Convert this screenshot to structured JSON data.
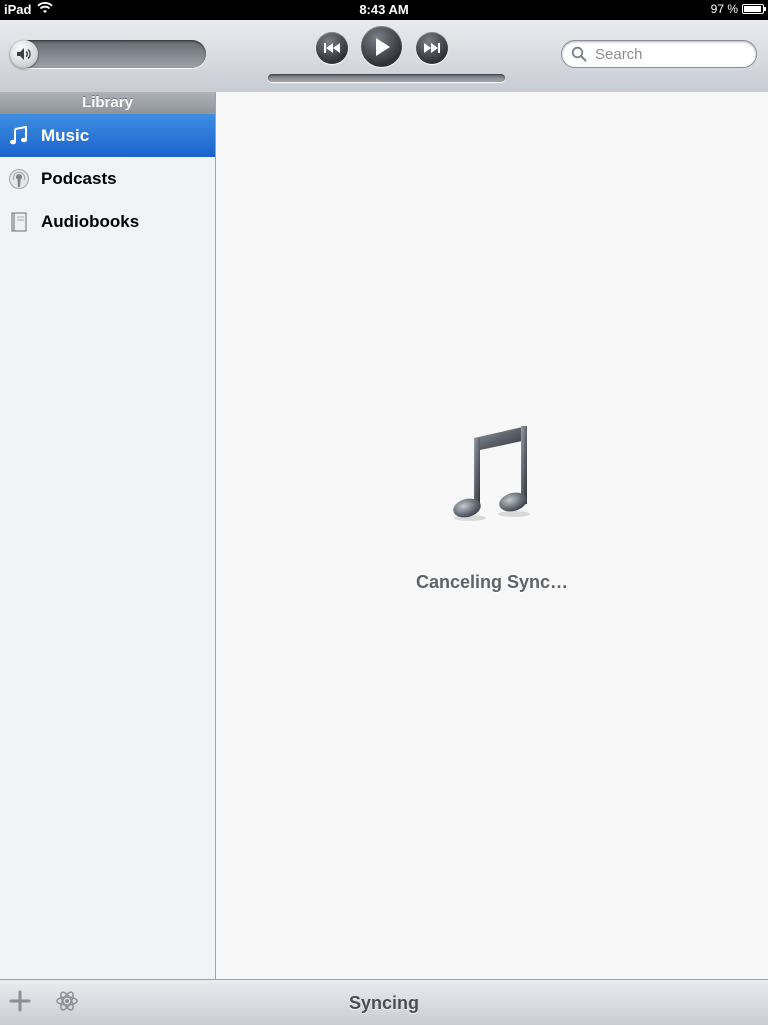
{
  "status_bar": {
    "device": "iPad",
    "time": "8:43 AM",
    "battery": "97 %",
    "battery_level": 0.97
  },
  "toolbar": {
    "prev_icon": "rewind-icon",
    "play_icon": "play-icon",
    "next_icon": "fast-forward-icon",
    "volume_icon": "speaker-icon",
    "search_placeholder": "Search",
    "search_value": ""
  },
  "sidebar": {
    "header": "Library",
    "items": [
      {
        "label": "Music",
        "icon": "music-note-icon",
        "selected": true
      },
      {
        "label": "Podcasts",
        "icon": "podcast-icon",
        "selected": false
      },
      {
        "label": "Audiobooks",
        "icon": "book-icon",
        "selected": false
      }
    ]
  },
  "main": {
    "message": "Canceling Sync…",
    "icon": "itunes-note-icon"
  },
  "bottom_bar": {
    "status": "Syncing",
    "add_icon": "plus-icon",
    "genius_icon": "genius-atom-icon"
  },
  "colors": {
    "selected_row": "#1b63cc",
    "status_bar": "#000000",
    "message_text": "#5f6266"
  }
}
